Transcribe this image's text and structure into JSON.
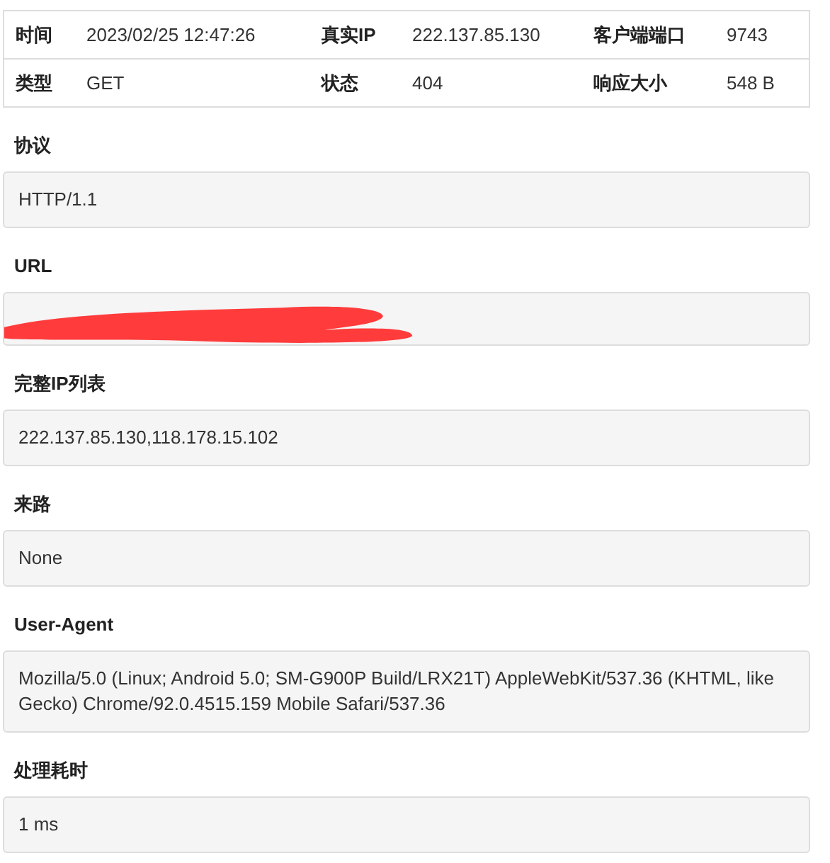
{
  "summary": {
    "rows": [
      [
        {
          "label": "时间",
          "value": "2023/02/25 12:47:26"
        },
        {
          "label": "真实IP",
          "value": "222.137.85.130"
        },
        {
          "label": "客户端端口",
          "value": "9743"
        }
      ],
      [
        {
          "label": "类型",
          "value": "GET"
        },
        {
          "label": "状态",
          "value": "404"
        },
        {
          "label": "响应大小",
          "value": "548 B"
        }
      ]
    ]
  },
  "fields": [
    {
      "label": "协议",
      "value": "HTTP/1.1"
    },
    {
      "label": "URL",
      "redacted": true
    },
    {
      "label": "完整IP列表",
      "value": "222.137.85.130,118.178.15.102"
    },
    {
      "label": "来路",
      "value": "None"
    },
    {
      "label": "User-Agent",
      "value": "Mozilla/5.0 (Linux; Android 5.0; SM-G900P Build/LRX21T) AppleWebKit/537.36 (KHTML, like Gecko) Chrome/92.0.4515.159 Mobile Safari/537.36"
    },
    {
      "label": "处理耗时",
      "value": "1 ms"
    }
  ]
}
